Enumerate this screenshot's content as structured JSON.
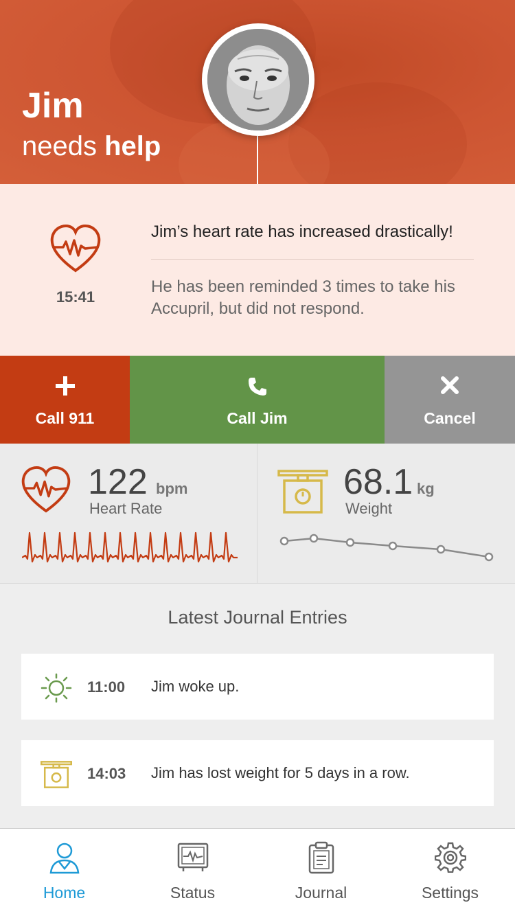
{
  "header": {
    "name": "Jim",
    "subtitle_prefix": "needs",
    "subtitle_bold": "help"
  },
  "alert": {
    "time": "15:41",
    "title": "Jim’s heart rate has increased drastically!",
    "message": "He has been reminded 3 times to take his Accupril, but did not respond.",
    "icon": "heart-rate-icon"
  },
  "actions": {
    "call_911": "Call 911",
    "call_jim": "Call Jim",
    "cancel": "Cancel"
  },
  "heart": {
    "value": "122",
    "unit": "bpm",
    "label": "Heart Rate"
  },
  "weight": {
    "value": "68.1",
    "unit": "kg",
    "label": "Weight"
  },
  "journal": {
    "title": "Latest Journal Entries",
    "entries": [
      {
        "time": "11:00",
        "text": "Jim woke up.",
        "icon": "sun-icon"
      },
      {
        "time": "14:03",
        "text": "Jim has lost weight for 5 days in a row.",
        "icon": "scale-icon"
      }
    ]
  },
  "tabs": [
    {
      "label": "Home",
      "icon": "person-icon",
      "active": true
    },
    {
      "label": "Status",
      "icon": "monitor-icon",
      "active": false
    },
    {
      "label": "Journal",
      "icon": "clipboard-icon",
      "active": false
    },
    {
      "label": "Settings",
      "icon": "gear-icon",
      "active": false
    }
  ],
  "colors": {
    "accent_red": "#c33c13",
    "call_green": "#629448",
    "cancel_gray": "#959595",
    "header_orange": "#cd5532",
    "alert_bg": "#fdeae4",
    "scale_yellow": "#d6b94a",
    "sun_green": "#6a9a4e",
    "active_blue": "#1e9ad6"
  }
}
